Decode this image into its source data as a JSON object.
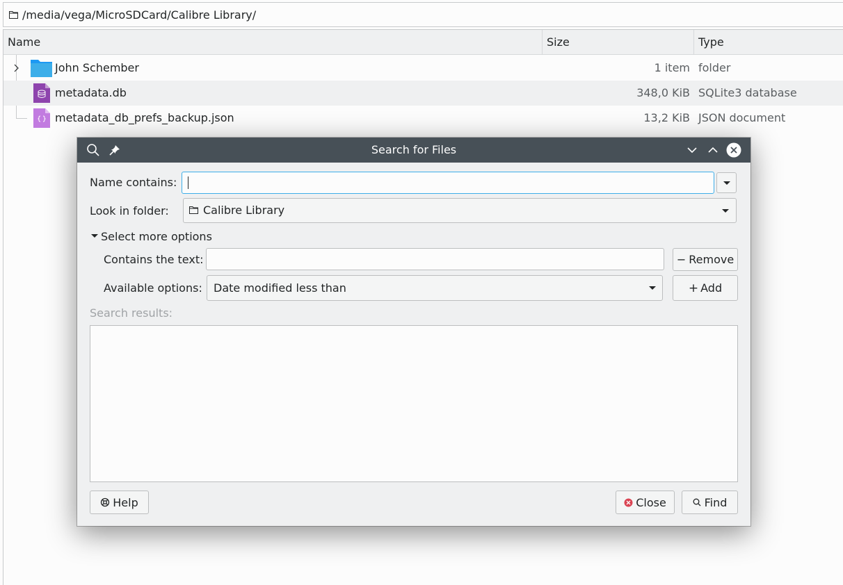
{
  "location": {
    "path": "/media/vega/MicroSDCard/Calibre Library/"
  },
  "columns": {
    "name": "Name",
    "size": "Size",
    "type": "Type"
  },
  "files": [
    {
      "name": "John Schember",
      "size": "1 item",
      "type": "folder",
      "icon": "folder-icon"
    },
    {
      "name": "metadata.db",
      "size": "348,0 KiB",
      "type": "SQLite3 database",
      "icon": "database-file-icon"
    },
    {
      "name": "metadata_db_prefs_backup.json",
      "size": "13,2 KiB",
      "type": "JSON document",
      "icon": "json-file-icon"
    }
  ],
  "dialog": {
    "title": "Search for Files",
    "name_contains_label": "Name contains:",
    "name_contains_value": "",
    "look_in_label": "Look in folder:",
    "look_in_value": "Calibre Library",
    "more_options_label": "Select more options",
    "contains_text_label": "Contains the text:",
    "contains_text_value": "",
    "remove_label": "Remove",
    "available_options_label": "Available options:",
    "available_options_value": "Date modified less than",
    "add_label": "Add",
    "results_label": "Search results:",
    "help_label": "Help",
    "close_label": "Close",
    "find_label": "Find"
  },
  "colors": {
    "titlebar": "#475057",
    "focus": "#3daee9",
    "folder": "#3daee9",
    "db_icon": "#8e44ad",
    "close_icon": "#da4453"
  }
}
